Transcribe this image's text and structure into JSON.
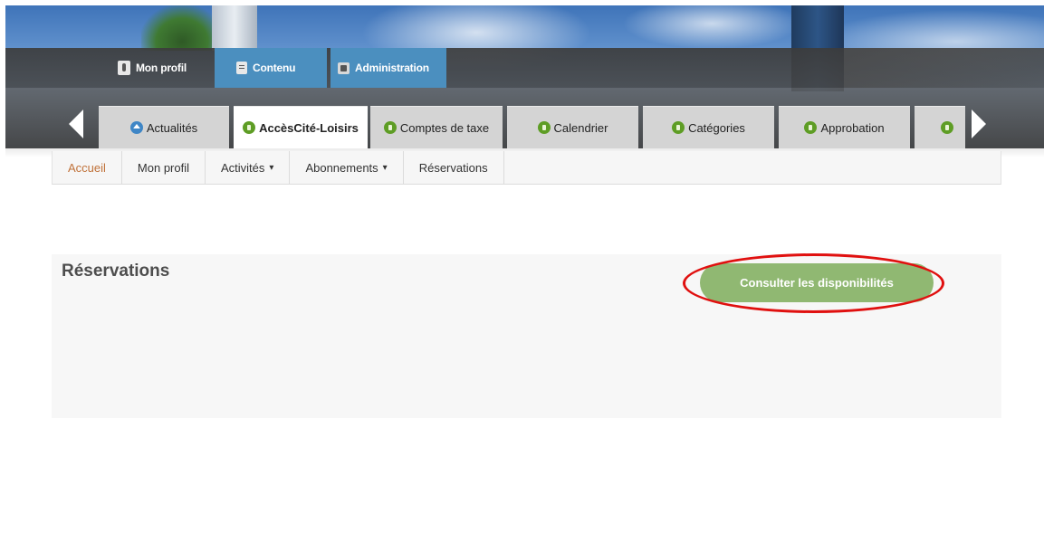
{
  "admin_bar": {
    "items": [
      {
        "label": "Mon profil",
        "icon": "user-icon"
      },
      {
        "label": "Contenu",
        "icon": "document-icon"
      },
      {
        "label": "Administration",
        "icon": "puzzle-icon"
      }
    ]
  },
  "tabs": [
    {
      "label": "Actualités",
      "icon": "home-icon",
      "active": false
    },
    {
      "label": "AccèsCité-Loisirs",
      "icon": "module-icon",
      "active": true
    },
    {
      "label": "Comptes de taxe",
      "icon": "module-icon",
      "active": false
    },
    {
      "label": "Calendrier",
      "icon": "module-icon",
      "active": false
    },
    {
      "label": "Catégories",
      "icon": "module-icon",
      "active": false
    },
    {
      "label": "Approbation",
      "icon": "module-icon",
      "active": false
    }
  ],
  "subnav": {
    "items": [
      {
        "label": "Accueil",
        "active": true
      },
      {
        "label": "Mon profil"
      },
      {
        "label": "Activités",
        "dropdown": true
      },
      {
        "label": "Abonnements",
        "dropdown": true
      },
      {
        "label": "Réservations"
      }
    ],
    "caret": "▾"
  },
  "panel": {
    "title": "Réservations",
    "button_label": "Consulter les disponibilités"
  },
  "colors": {
    "admin_blue": "#4b8fbf",
    "cta_green": "#90b872",
    "active_link": "#c0723a",
    "highlight_red": "#e0100f",
    "tab_icon_green": "#5e9d25"
  }
}
